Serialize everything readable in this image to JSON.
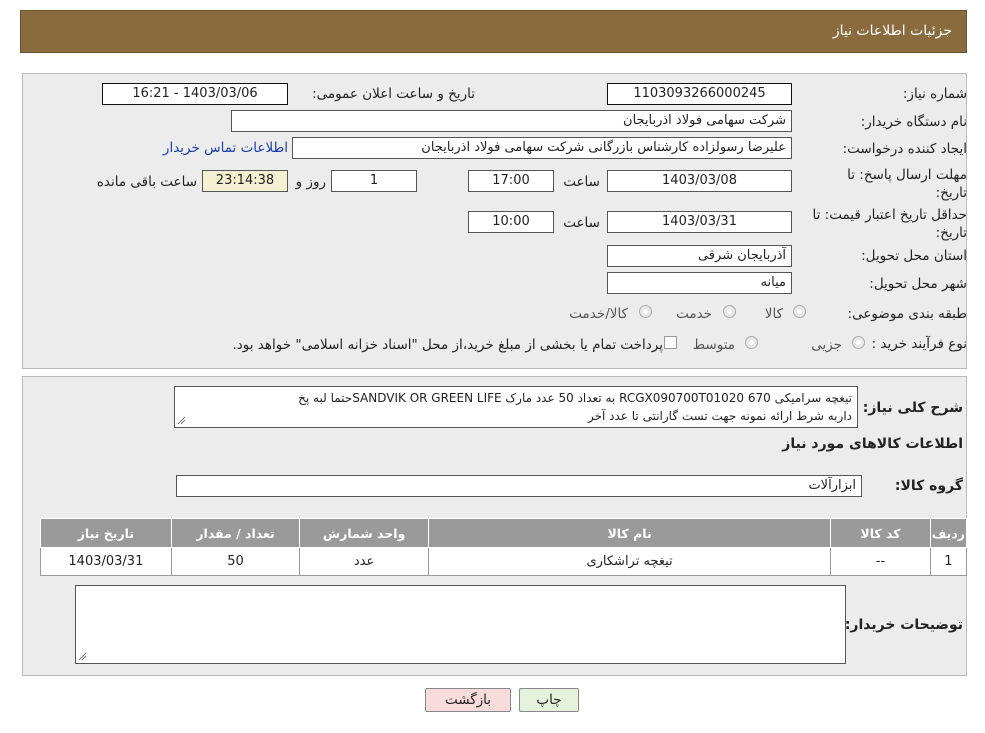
{
  "header": {
    "title": "جزئیات اطلاعات نیاز"
  },
  "form": {
    "need_number_label": "شماره نیاز:",
    "need_number": "1103093266000245",
    "announce_label": "تاریخ و ساعت اعلان عمومی:",
    "announce_value": "1403/03/06 - 16:21",
    "buyer_org_label": "نام دستگاه خریدار:",
    "buyer_org": "شرکت سهامی فولاد اذربایجان",
    "creator_label": "ایجاد کننده درخواست:",
    "creator": "علیرضا رسولزاده کارشناس بازرگانی شرکت سهامی فولاد اذربایجان",
    "contact_link": "اطلاعات تماس خریدار",
    "reply_deadline_label": "مهلت ارسال پاسخ: تا تاریخ:",
    "reply_date": "1403/03/08",
    "time_label": "ساعت",
    "reply_time": "17:00",
    "reply_days": "1",
    "days_and_label": "روز و",
    "remaining_time": "23:14:38",
    "remaining_label": "ساعت باقی مانده",
    "price_validity_label": "حداقل تاریخ اعتبار قیمت: تا تاریخ:",
    "price_date": "1403/03/31",
    "price_time": "10:00",
    "province_label": "استان محل تحویل:",
    "province": "آذربایجان شرقی",
    "city_label": "شهر محل تحویل:",
    "city": "میانه",
    "category_label": "طبقه بندی موضوعی:",
    "category_options": [
      "کالا",
      "خدمت",
      "کالا/خدمت"
    ],
    "process_label": "نوع فرآیند خرید :",
    "process_options": [
      "جزیی",
      "متوسط"
    ],
    "process_note": "پرداخت تمام یا بخشی از مبلغ خرید،از محل \"اسناد خزانه اسلامی\" خواهد بود."
  },
  "details": {
    "summary_label": "شرح کلی نیاز:",
    "summary_line1": "تیغچه سرامیکی RCGX090700T01020 670  به تعداد 50 عدد مارک SANDVIK OR GREEN LIFEحتما لبه پخ",
    "summary_line2": "داربه شرط ارائه نمونه جهت تست گارانتی تا عدد آخر",
    "goods_info_title": "اطلاعات کالاهای مورد نیاز",
    "goods_group_label": "گروه کالا:",
    "goods_group": "ابزارآلات",
    "table_headers": [
      "ردیف",
      "کد کالا",
      "نام کالا",
      "واحد شمارش",
      "تعداد / مقدار",
      "تاریخ نیاز"
    ],
    "table_rows": [
      [
        "1",
        "--",
        "تیغچه تراشکاری",
        "عدد",
        "50",
        "1403/03/31"
      ]
    ],
    "buyer_notes_label": "توضیحات خریدار:",
    "buyer_notes": ""
  },
  "buttons": {
    "print": "چاپ",
    "back": "بازگشت"
  },
  "colors": {
    "header": "#8a6b3e",
    "panel": "#ececec",
    "link": "#1a3fa8",
    "back_button": "#f8dcdc"
  }
}
